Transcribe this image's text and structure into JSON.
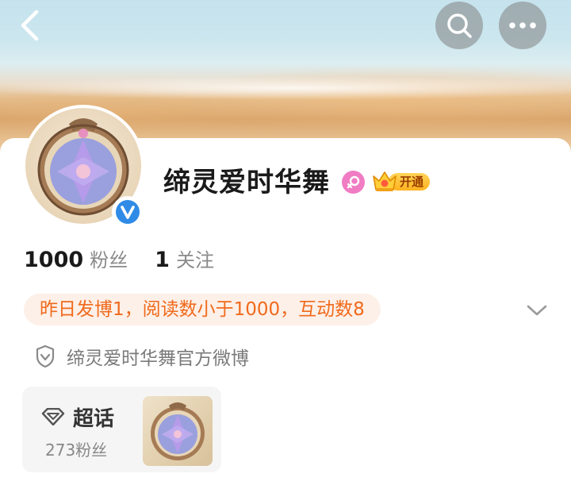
{
  "profile": {
    "name": "缔灵爱时华舞",
    "vip_label": "开通",
    "followers_count": "1000",
    "followers_label": "粉丝",
    "following_count": "1",
    "following_label": "关注",
    "notice": "昨日发博1，阅读数小于1000，互动数8",
    "verification": "缔灵爱时华舞官方微博"
  },
  "super_topic": {
    "label": "超话",
    "fans": "273粉丝"
  },
  "icons": {
    "back": "back-arrow-icon",
    "search": "search-icon",
    "more": "more-dots-icon",
    "verified": "verified-v-icon",
    "gender": "female-icon",
    "vip": "crown-icon",
    "expand": "chevron-down-icon",
    "shield": "shield-check-icon",
    "diamond": "diamond-icon"
  },
  "colors": {
    "accent_orange": "#f06a1c",
    "notice_bg": "#fdf0e8",
    "verified_blue": "#2f8be6",
    "gender_pink": "#f07cc3",
    "vip_gold": "#ffb21f"
  }
}
